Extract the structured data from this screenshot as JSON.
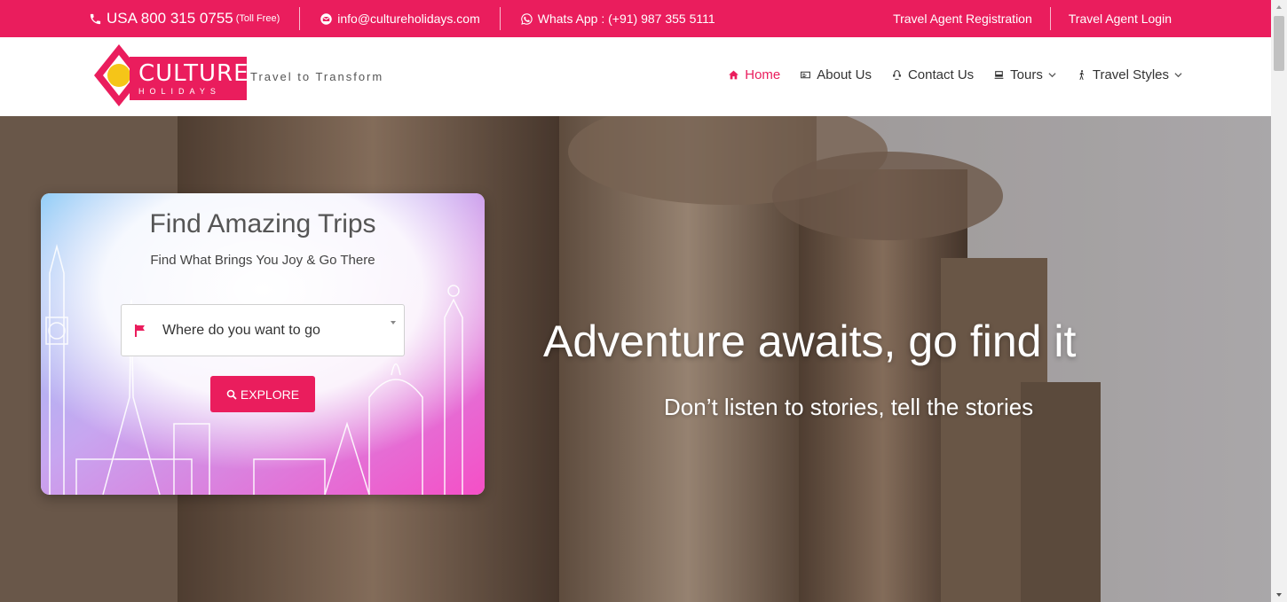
{
  "topbar": {
    "phone": "USA 800 315 0755",
    "phone_note": "(Toll Free)",
    "email": "info@cultureholidays.com",
    "whatsapp": "Whats App : (+91) 987 355 5111",
    "agent_registration": "Travel Agent Registration",
    "agent_login": "Travel Agent Login"
  },
  "header": {
    "logo_main": "CULTURE",
    "logo_sub": "HOLIDAYS",
    "tagline": "Travel to Transform"
  },
  "nav": {
    "items": [
      {
        "label": "Home",
        "icon": "home-icon"
      },
      {
        "label": "About Us",
        "icon": "id-card-icon"
      },
      {
        "label": "Contact Us",
        "icon": "contact-icon"
      },
      {
        "label": "Tours",
        "icon": "bus-icon"
      },
      {
        "label": "Travel Styles",
        "icon": "hiker-icon"
      }
    ]
  },
  "search_card": {
    "title": "Find Amazing Trips",
    "subtitle": "Find What Brings You Joy & Go There",
    "select_value": "Where do you want to go",
    "button_label": "EXPLORE"
  },
  "hero": {
    "title": "Adventure awaits, go find it",
    "subtitle": "Don’t listen to stories, tell the stories"
  },
  "colors": {
    "brand": "#ea1d5d",
    "logo_accent": "#f5c518"
  }
}
